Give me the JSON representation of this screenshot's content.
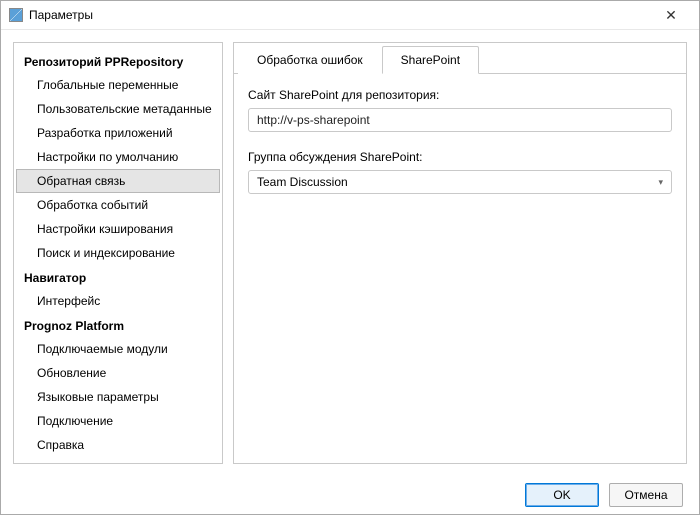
{
  "window": {
    "title": "Параметры",
    "close_glyph": "✕"
  },
  "sidebar": {
    "sections": [
      {
        "title": "Репозиторий  PPRepository",
        "items": [
          {
            "label": "Глобальные переменные",
            "selected": false
          },
          {
            "label": "Пользовательские метаданные",
            "selected": false
          },
          {
            "label": "Разработка приложений",
            "selected": false
          },
          {
            "label": "Настройки по умолчанию",
            "selected": false
          },
          {
            "label": "Обратная связь",
            "selected": true
          },
          {
            "label": "Обработка событий",
            "selected": false
          },
          {
            "label": "Настройки кэширования",
            "selected": false
          },
          {
            "label": "Поиск и индексирование",
            "selected": false
          }
        ]
      },
      {
        "title": "Навигатор",
        "items": [
          {
            "label": "Интерфейс",
            "selected": false
          }
        ]
      },
      {
        "title": "Prognoz Platform",
        "items": [
          {
            "label": "Подключаемые модули",
            "selected": false
          },
          {
            "label": "Обновление",
            "selected": false
          },
          {
            "label": "Языковые параметры",
            "selected": false
          },
          {
            "label": "Подключение",
            "selected": false
          },
          {
            "label": "Справка",
            "selected": false
          }
        ]
      }
    ]
  },
  "main": {
    "tabs": [
      {
        "label": "Обработка ошибок",
        "active": false
      },
      {
        "label": "SharePoint",
        "active": true
      }
    ],
    "site_label": "Сайт SharePoint для репозитория:",
    "site_value": "http://v-ps-sharepoint",
    "group_label": "Группа обсуждения SharePoint:",
    "group_value": "Team Discussion",
    "combo_arrow": "▾"
  },
  "footer": {
    "ok_label": "OK",
    "cancel_label": "Отмена"
  }
}
